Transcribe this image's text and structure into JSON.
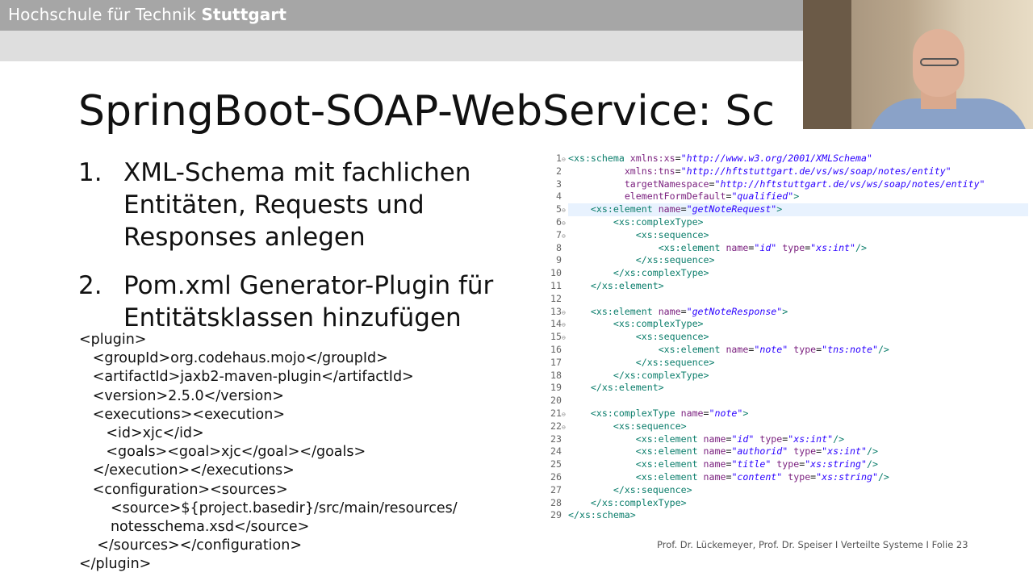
{
  "header": {
    "brand_prefix": "Hochschule",
    "brand_middle": "für Technik",
    "brand_bold": "Stuttgart"
  },
  "slide": {
    "title": "SpringBoot-SOAP-WebService: Sc",
    "steps": [
      {
        "num": "1.",
        "text": "XML-Schema mit fachlichen Entitäten, Requests und Responses anlegen"
      },
      {
        "num": "2.",
        "text": "Pom.xml Generator-Plugin für Entitätsklassen hinzufügen"
      }
    ],
    "plugin_lines": [
      "<plugin>",
      "   <groupId>org.codehaus.mojo</groupId>",
      "   <artifactId>jaxb2-maven-plugin</artifactId>",
      "   <version>2.5.0</version>",
      "   <executions><execution>",
      "      <id>xjc</id>",
      "      <goals><goal>xjc</goal></goals>",
      "   </execution></executions>",
      "   <configuration><sources>",
      "       <source>${project.basedir}/src/main/resources/",
      "       notesschema.xsd</source>",
      "    </sources></configuration>",
      "</plugin>"
    ],
    "footer": "Prof. Dr. Lückemeyer, Prof. Dr. Speiser I Verteilte Systeme I Folie 23"
  },
  "code": {
    "lines": [
      {
        "n": "1",
        "fold": "⊖",
        "segs": [
          [
            "tag",
            "<xs:schema "
          ],
          [
            "attr",
            "xmlns:xs"
          ],
          [
            "plain",
            "="
          ],
          [
            "val",
            "\"http://www.w3.org/2001/XMLSchema\""
          ]
        ]
      },
      {
        "n": "2",
        "fold": "",
        "segs": [
          [
            "plain",
            "          "
          ],
          [
            "attr",
            "xmlns:tns"
          ],
          [
            "plain",
            "="
          ],
          [
            "val",
            "\"http://hftstuttgart.de/vs/ws/soap/notes/entity\""
          ]
        ]
      },
      {
        "n": "3",
        "fold": "",
        "segs": [
          [
            "plain",
            "          "
          ],
          [
            "attr",
            "targetNamespace"
          ],
          [
            "plain",
            "="
          ],
          [
            "val",
            "\"http://hftstuttgart.de/vs/ws/soap/notes/entity\""
          ]
        ]
      },
      {
        "n": "4",
        "fold": "",
        "segs": [
          [
            "plain",
            "          "
          ],
          [
            "attr",
            "elementFormDefault"
          ],
          [
            "plain",
            "="
          ],
          [
            "val",
            "\"qualified\""
          ],
          [
            "tag",
            ">"
          ]
        ]
      },
      {
        "n": "5",
        "fold": "⊖",
        "hl": true,
        "segs": [
          [
            "plain",
            "    "
          ],
          [
            "tag",
            "<xs:element "
          ],
          [
            "attr",
            "name"
          ],
          [
            "plain",
            "="
          ],
          [
            "val",
            "\"getNoteRequest\""
          ],
          [
            "tag",
            ">"
          ]
        ]
      },
      {
        "n": "6",
        "fold": "⊖",
        "segs": [
          [
            "plain",
            "        "
          ],
          [
            "tag",
            "<xs:complexType>"
          ]
        ]
      },
      {
        "n": "7",
        "fold": "⊖",
        "segs": [
          [
            "plain",
            "            "
          ],
          [
            "tag",
            "<xs:sequence>"
          ]
        ]
      },
      {
        "n": "8",
        "fold": "",
        "segs": [
          [
            "plain",
            "                "
          ],
          [
            "tag",
            "<xs:element "
          ],
          [
            "attr",
            "name"
          ],
          [
            "plain",
            "="
          ],
          [
            "val",
            "\"id\""
          ],
          [
            "plain",
            " "
          ],
          [
            "attr",
            "type"
          ],
          [
            "plain",
            "="
          ],
          [
            "val",
            "\"xs:int\""
          ],
          [
            "tag",
            "/>"
          ]
        ]
      },
      {
        "n": "9",
        "fold": "",
        "segs": [
          [
            "plain",
            "            "
          ],
          [
            "tag",
            "</xs:sequence>"
          ]
        ]
      },
      {
        "n": "10",
        "fold": "",
        "segs": [
          [
            "plain",
            "        "
          ],
          [
            "tag",
            "</xs:complexType>"
          ]
        ]
      },
      {
        "n": "11",
        "fold": "",
        "segs": [
          [
            "plain",
            "    "
          ],
          [
            "tag",
            "</xs:element>"
          ]
        ]
      },
      {
        "n": "12",
        "fold": "",
        "segs": []
      },
      {
        "n": "13",
        "fold": "⊖",
        "segs": [
          [
            "plain",
            "    "
          ],
          [
            "tag",
            "<xs:element "
          ],
          [
            "attr",
            "name"
          ],
          [
            "plain",
            "="
          ],
          [
            "val",
            "\"getNoteResponse\""
          ],
          [
            "tag",
            ">"
          ]
        ]
      },
      {
        "n": "14",
        "fold": "⊖",
        "segs": [
          [
            "plain",
            "        "
          ],
          [
            "tag",
            "<xs:complexType>"
          ]
        ]
      },
      {
        "n": "15",
        "fold": "⊖",
        "segs": [
          [
            "plain",
            "            "
          ],
          [
            "tag",
            "<xs:sequence>"
          ]
        ]
      },
      {
        "n": "16",
        "fold": "",
        "segs": [
          [
            "plain",
            "                "
          ],
          [
            "tag",
            "<xs:element "
          ],
          [
            "attr",
            "name"
          ],
          [
            "plain",
            "="
          ],
          [
            "val",
            "\"note\""
          ],
          [
            "plain",
            " "
          ],
          [
            "attr",
            "type"
          ],
          [
            "plain",
            "="
          ],
          [
            "val",
            "\"tns:note\""
          ],
          [
            "tag",
            "/>"
          ]
        ]
      },
      {
        "n": "17",
        "fold": "",
        "segs": [
          [
            "plain",
            "            "
          ],
          [
            "tag",
            "</xs:sequence>"
          ]
        ]
      },
      {
        "n": "18",
        "fold": "",
        "segs": [
          [
            "plain",
            "        "
          ],
          [
            "tag",
            "</xs:complexType>"
          ]
        ]
      },
      {
        "n": "19",
        "fold": "",
        "segs": [
          [
            "plain",
            "    "
          ],
          [
            "tag",
            "</xs:element>"
          ]
        ]
      },
      {
        "n": "20",
        "fold": "",
        "segs": []
      },
      {
        "n": "21",
        "fold": "⊖",
        "segs": [
          [
            "plain",
            "    "
          ],
          [
            "tag",
            "<xs:complexType "
          ],
          [
            "attr",
            "name"
          ],
          [
            "plain",
            "="
          ],
          [
            "val",
            "\"note\""
          ],
          [
            "tag",
            ">"
          ]
        ]
      },
      {
        "n": "22",
        "fold": "⊖",
        "segs": [
          [
            "plain",
            "        "
          ],
          [
            "tag",
            "<xs:sequence>"
          ]
        ]
      },
      {
        "n": "23",
        "fold": "",
        "segs": [
          [
            "plain",
            "            "
          ],
          [
            "tag",
            "<xs:element "
          ],
          [
            "attr",
            "name"
          ],
          [
            "plain",
            "="
          ],
          [
            "val",
            "\"id\""
          ],
          [
            "plain",
            " "
          ],
          [
            "attr",
            "type"
          ],
          [
            "plain",
            "="
          ],
          [
            "val",
            "\"xs:int\""
          ],
          [
            "tag",
            "/>"
          ]
        ]
      },
      {
        "n": "24",
        "fold": "",
        "segs": [
          [
            "plain",
            "            "
          ],
          [
            "tag",
            "<xs:element "
          ],
          [
            "attr",
            "name"
          ],
          [
            "plain",
            "="
          ],
          [
            "val",
            "\"authorid\""
          ],
          [
            "plain",
            " "
          ],
          [
            "attr",
            "type"
          ],
          [
            "plain",
            "="
          ],
          [
            "val",
            "\"xs:int\""
          ],
          [
            "tag",
            "/>"
          ]
        ]
      },
      {
        "n": "25",
        "fold": "",
        "segs": [
          [
            "plain",
            "            "
          ],
          [
            "tag",
            "<xs:element "
          ],
          [
            "attr",
            "name"
          ],
          [
            "plain",
            "="
          ],
          [
            "val",
            "\"title\""
          ],
          [
            "plain",
            " "
          ],
          [
            "attr",
            "type"
          ],
          [
            "plain",
            "="
          ],
          [
            "val",
            "\"xs:string\""
          ],
          [
            "tag",
            "/>"
          ]
        ]
      },
      {
        "n": "26",
        "fold": "",
        "segs": [
          [
            "plain",
            "            "
          ],
          [
            "tag",
            "<xs:element "
          ],
          [
            "attr",
            "name"
          ],
          [
            "plain",
            "="
          ],
          [
            "val",
            "\"content\""
          ],
          [
            "plain",
            " "
          ],
          [
            "attr",
            "type"
          ],
          [
            "plain",
            "="
          ],
          [
            "val",
            "\"xs:string\""
          ],
          [
            "tag",
            "/>"
          ]
        ]
      },
      {
        "n": "27",
        "fold": "",
        "segs": [
          [
            "plain",
            "        "
          ],
          [
            "tag",
            "</xs:sequence>"
          ]
        ]
      },
      {
        "n": "28",
        "fold": "",
        "segs": [
          [
            "plain",
            "    "
          ],
          [
            "tag",
            "</xs:complexType>"
          ]
        ]
      },
      {
        "n": "29",
        "fold": "",
        "segs": [
          [
            "tag",
            "</xs:schema>"
          ]
        ]
      }
    ]
  },
  "colors": {
    "header_bar": "#a6a6a6",
    "sub_bar": "#dedede",
    "xml_tag": "#0a7d6b",
    "xml_attr": "#7a1f7e",
    "xml_value": "#2a00ff",
    "highlight_line": "#e8f2fe"
  }
}
